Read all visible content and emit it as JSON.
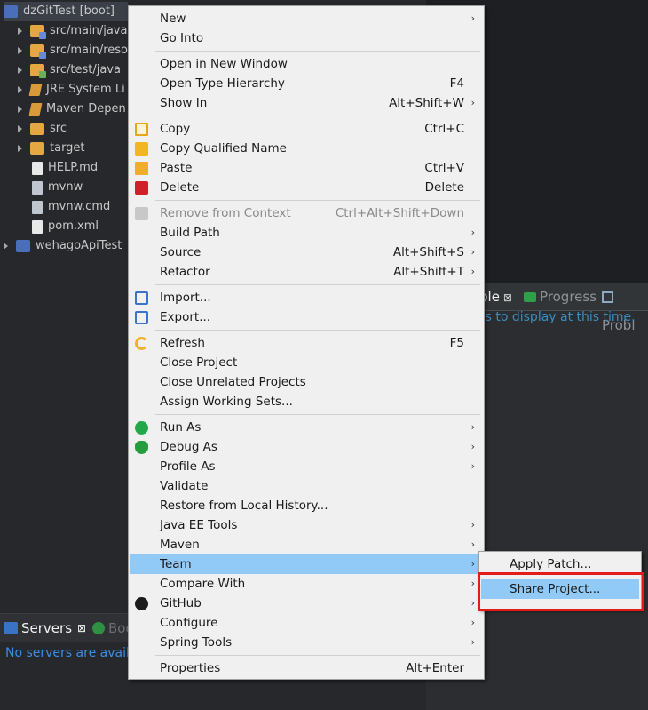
{
  "explorer": {
    "items": [
      {
        "label": "dzGitTest [boot]",
        "icon": "project-icon",
        "selected": true
      },
      {
        "label": "src/main/java",
        "icon": "source-folder-icon"
      },
      {
        "label": "src/main/reso",
        "icon": "source-folder-icon"
      },
      {
        "label": "src/test/java",
        "icon": "test-folder-icon"
      },
      {
        "label": "JRE System Li",
        "icon": "library-icon"
      },
      {
        "label": "Maven Depen",
        "icon": "library-icon"
      },
      {
        "label": "src",
        "icon": "folder-icon"
      },
      {
        "label": "target",
        "icon": "folder-icon"
      },
      {
        "label": "HELP.md",
        "icon": "file-icon"
      },
      {
        "label": "mvnw",
        "icon": "file-icon"
      },
      {
        "label": "mvnw.cmd",
        "icon": "file-icon"
      },
      {
        "label": "pom.xml",
        "icon": "file-icon"
      },
      {
        "label": "wehagoApiTest",
        "icon": "project-icon"
      }
    ]
  },
  "right_view": {
    "tabs": [
      {
        "label": "ble",
        "close": "⊠"
      },
      {
        "label": "Progress"
      },
      {
        "label": "Probl"
      }
    ],
    "message": "es to display at this time."
  },
  "servers_view": {
    "tabs": [
      {
        "label": "Servers",
        "close": "⊠"
      },
      {
        "label": "Boo"
      }
    ],
    "message": "No servers are availab"
  },
  "context_menu": {
    "items": [
      {
        "label": "New",
        "accel": "",
        "submenu": true
      },
      {
        "label": "Go Into",
        "accel": ""
      },
      {
        "label": "Open in New Window",
        "accel": ""
      },
      {
        "label": "Open Type Hierarchy",
        "accel": "F4"
      },
      {
        "label": "Show In",
        "accel": "Alt+Shift+W",
        "submenu": true
      },
      {
        "label": "Copy",
        "accel": "Ctrl+C",
        "icon": "copy-icon"
      },
      {
        "label": "Copy Qualified Name",
        "accel": "",
        "icon": "copy-qualified-name-icon"
      },
      {
        "label": "Paste",
        "accel": "Ctrl+V",
        "icon": "paste-icon"
      },
      {
        "label": "Delete",
        "accel": "Delete",
        "icon": "delete-icon"
      },
      {
        "label": "Remove from Context",
        "accel": "Ctrl+Alt+Shift+Down",
        "icon": "remove-from-context-icon",
        "disabled": true
      },
      {
        "label": "Build Path",
        "accel": "",
        "submenu": true
      },
      {
        "label": "Source",
        "accel": "Alt+Shift+S",
        "submenu": true
      },
      {
        "label": "Refactor",
        "accel": "Alt+Shift+T",
        "submenu": true
      },
      {
        "label": "Import...",
        "accel": "",
        "icon": "import-icon"
      },
      {
        "label": "Export...",
        "accel": "",
        "icon": "export-icon"
      },
      {
        "label": "Refresh",
        "accel": "F5",
        "icon": "refresh-icon"
      },
      {
        "label": "Close Project",
        "accel": ""
      },
      {
        "label": "Close Unrelated Projects",
        "accel": ""
      },
      {
        "label": "Assign Working Sets...",
        "accel": ""
      },
      {
        "label": "Run As",
        "accel": "",
        "submenu": true,
        "icon": "run-icon"
      },
      {
        "label": "Debug As",
        "accel": "",
        "submenu": true,
        "icon": "debug-icon"
      },
      {
        "label": "Profile As",
        "accel": "",
        "submenu": true
      },
      {
        "label": "Validate",
        "accel": ""
      },
      {
        "label": "Restore from Local History...",
        "accel": ""
      },
      {
        "label": "Java EE Tools",
        "accel": "",
        "submenu": true
      },
      {
        "label": "Maven",
        "accel": "",
        "submenu": true
      },
      {
        "label": "Team",
        "accel": "",
        "submenu": true,
        "highlighted": true
      },
      {
        "label": "Compare With",
        "accel": "",
        "submenu": true
      },
      {
        "label": "GitHub",
        "accel": "",
        "submenu": true,
        "icon": "github-icon"
      },
      {
        "label": "Configure",
        "accel": "",
        "submenu": true
      },
      {
        "label": "Spring Tools",
        "accel": "",
        "submenu": true
      },
      {
        "label": "Properties",
        "accel": "Alt+Enter"
      }
    ],
    "submenu_arrow": "›"
  },
  "team_submenu": {
    "items": [
      {
        "label": "Apply Patch..."
      },
      {
        "label": "Share Project...",
        "highlighted": true
      }
    ]
  },
  "colors": {
    "menu_highlight": "#91c9f7",
    "annotation_box": "#e41b1b"
  }
}
